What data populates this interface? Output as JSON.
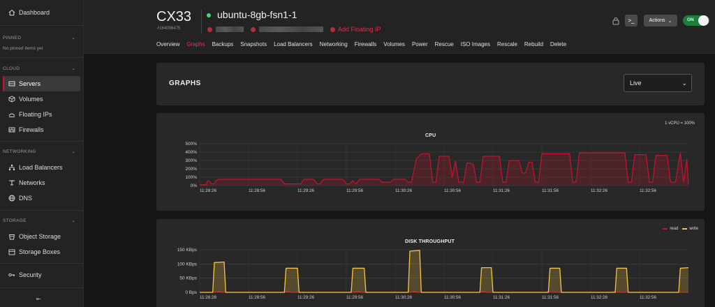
{
  "sidebar": {
    "dashboard": "Dashboard",
    "pinned": {
      "title": "PINNED",
      "note": "No pinned items yet"
    },
    "cloud": {
      "title": "CLOUD",
      "items": [
        "Servers",
        "Volumes",
        "Floating IPs",
        "Firewalls"
      ]
    },
    "networking": {
      "title": "NETWORKING",
      "items": [
        "Load Balancers",
        "Networks",
        "DNS"
      ]
    },
    "storage": {
      "title": "STORAGE",
      "items": [
        "Object Storage",
        "Storage Boxes"
      ]
    },
    "security": "Security",
    "toggle_icon": "sidebar-collapse-icon"
  },
  "header": {
    "server_type": "CX33",
    "server_id": "#164096475",
    "server_name": "ubuntu-8gb-fsn1-1",
    "add_floating_ip": "Add Floating IP",
    "actions_label": "Actions",
    "console_label": ">_",
    "power_label": "ON",
    "status_color": "#3ddc84",
    "tabs": [
      "Overview",
      "Graphs",
      "Backups",
      "Snapshots",
      "Load Balancers",
      "Networking",
      "Firewalls",
      "Volumes",
      "Power",
      "Rescue",
      "ISO Images",
      "Rescale",
      "Rebuild",
      "Delete"
    ],
    "active_tab": "Graphs"
  },
  "graphs": {
    "title": "GRAPHS",
    "range": "Live"
  },
  "chart_data": [
    {
      "type": "area",
      "title": "CPU",
      "note": "1 vCPU = 100%",
      "y_ticks": [
        "500%",
        "400%",
        "300%",
        "200%",
        "100%",
        "0%"
      ],
      "ylim": [
        0,
        500
      ],
      "x_ticks": [
        "11:28:26",
        "11:28:56",
        "11:29:26",
        "11:29:56",
        "11:30:26",
        "11:30:56",
        "11:31:26",
        "11:31:56",
        "11:32:26",
        "11:32:56"
      ],
      "xlim": [
        0,
        300
      ],
      "series": [
        {
          "color": "#c8102e",
          "points": [
            [
              0,
              10
            ],
            [
              4,
              10
            ],
            [
              5,
              60
            ],
            [
              6,
              50
            ],
            [
              7,
              20
            ],
            [
              9,
              20
            ],
            [
              10,
              60
            ],
            [
              12,
              75
            ],
            [
              50,
              75
            ],
            [
              52,
              20
            ],
            [
              62,
              20
            ],
            [
              64,
              75
            ],
            [
              70,
              75
            ],
            [
              72,
              20
            ],
            [
              74,
              20
            ],
            [
              76,
              75
            ],
            [
              88,
              75
            ],
            [
              90,
              20
            ],
            [
              92,
              20
            ],
            [
              94,
              60
            ],
            [
              96,
              20
            ],
            [
              98,
              75
            ],
            [
              110,
              75
            ],
            [
              112,
              40
            ],
            [
              117,
              40
            ],
            [
              119,
              75
            ],
            [
              126,
              75
            ],
            [
              128,
              40
            ],
            [
              130,
              40
            ],
            [
              133,
              320
            ],
            [
              136,
              380
            ],
            [
              141,
              380
            ],
            [
              143,
              40
            ],
            [
              145,
              40
            ],
            [
              147,
              350
            ],
            [
              153,
              350
            ],
            [
              155,
              100
            ],
            [
              157,
              290
            ],
            [
              159,
              40
            ],
            [
              162,
              40
            ],
            [
              164,
              270
            ],
            [
              166,
              270
            ],
            [
              168,
              250
            ],
            [
              170,
              40
            ],
            [
              172,
              40
            ],
            [
              174,
              350
            ],
            [
              184,
              350
            ],
            [
              186,
              40
            ],
            [
              188,
              40
            ],
            [
              190,
              300
            ],
            [
              196,
              300
            ],
            [
              198,
              150
            ],
            [
              200,
              150
            ],
            [
              202,
              280
            ],
            [
              204,
              280
            ],
            [
              206,
              40
            ],
            [
              208,
              40
            ],
            [
              210,
              380
            ],
            [
              227,
              380
            ],
            [
              229,
              40
            ],
            [
              231,
              40
            ],
            [
              233,
              390
            ],
            [
              261,
              390
            ],
            [
              263,
              40
            ],
            [
              265,
              40
            ],
            [
              267,
              370
            ],
            [
              274,
              370
            ],
            [
              276,
              40
            ],
            [
              278,
              40
            ],
            [
              280,
              360
            ],
            [
              287,
              360
            ],
            [
              289,
              40
            ],
            [
              292,
              40
            ],
            [
              295,
              390
            ],
            [
              297,
              40
            ],
            [
              299,
              310
            ],
            [
              300,
              20
            ]
          ]
        }
      ]
    },
    {
      "type": "area",
      "title": "DISK THROUGHPUT",
      "legend": [
        {
          "name": "read",
          "color": "#c8102e"
        },
        {
          "name": "write",
          "color": "#f5c542"
        }
      ],
      "y_ticks": [
        "150 KBps",
        "100 KBps",
        "50 KBps",
        "0 Bps"
      ],
      "ylim": [
        0,
        150
      ],
      "x_ticks": [
        "11:28:26",
        "11:28:56",
        "11:29:26",
        "11:29:56",
        "11:30:26",
        "11:30:56",
        "11:31:26",
        "11:31:56",
        "11:32:26",
        "11:32:56"
      ],
      "xlim": [
        0,
        300
      ],
      "series": [
        {
          "name": "read",
          "color": "#c8102e",
          "points": [
            [
              0,
              0
            ],
            [
              10,
              0
            ],
            [
              12,
              3
            ],
            [
              14,
              0
            ],
            [
              52,
              0
            ],
            [
              54,
              3
            ],
            [
              56,
              0
            ],
            [
              95,
              0
            ],
            [
              97,
              3
            ],
            [
              99,
              0
            ],
            [
              130,
              0
            ],
            [
              132,
              3
            ],
            [
              134,
              0
            ],
            [
              172,
              0
            ],
            [
              174,
              3
            ],
            [
              176,
              0
            ],
            [
              212,
              0
            ],
            [
              214,
              3
            ],
            [
              216,
              0
            ],
            [
              252,
              0
            ],
            [
              254,
              3
            ],
            [
              256,
              0
            ],
            [
              300,
              0
            ]
          ]
        },
        {
          "name": "write",
          "color": "#f5c542",
          "points": [
            [
              0,
              0
            ],
            [
              8,
              0
            ],
            [
              9,
              105
            ],
            [
              15,
              107
            ],
            [
              16,
              0
            ],
            [
              52,
              0
            ],
            [
              53,
              85
            ],
            [
              60,
              85
            ],
            [
              61,
              0
            ],
            [
              93,
              0
            ],
            [
              94,
              85
            ],
            [
              101,
              85
            ],
            [
              102,
              0
            ],
            [
              128,
              0
            ],
            [
              129,
              145
            ],
            [
              135,
              148
            ],
            [
              136,
              0
            ],
            [
              172,
              0
            ],
            [
              173,
              87
            ],
            [
              179,
              87
            ],
            [
              180,
              0
            ],
            [
              214,
              0
            ],
            [
              215,
              85
            ],
            [
              221,
              85
            ],
            [
              222,
              0
            ],
            [
              255,
              0
            ],
            [
              256,
              85
            ],
            [
              262,
              85
            ],
            [
              263,
              0
            ],
            [
              294,
              0
            ],
            [
              295,
              85
            ],
            [
              300,
              87
            ]
          ]
        }
      ]
    }
  ]
}
